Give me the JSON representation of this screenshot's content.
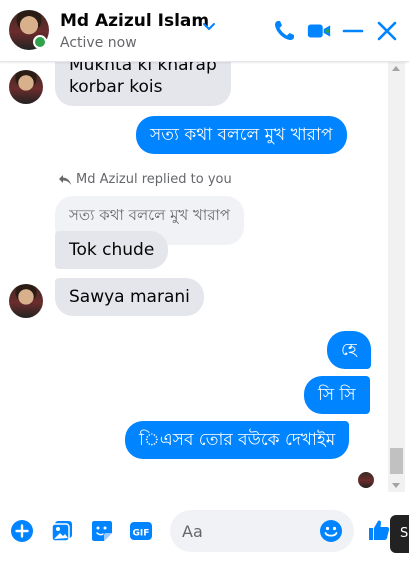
{
  "header": {
    "name": "Md Azizul Islam",
    "status": "Active now"
  },
  "messages": {
    "partial_top_line1": "Mukhta ki kharap",
    "partial_top_line2": "korbar kois",
    "out_1": "সত্য কথা বললে মুখ খারাপ",
    "reply_note": "Md Azizul replied to you",
    "quoted": "সত্য কথা বললে মুখ খারাপ",
    "in_1": "Tok chude",
    "in_2": "Sawya marani",
    "out_2": "হে",
    "out_3": "সি সি",
    "out_4": "িএসব তোর বউকে দেখাইম"
  },
  "composer": {
    "placeholder": "Aa",
    "tooltip_text": "S"
  },
  "colors": {
    "accent": "#0084ff",
    "incoming_bubble": "#e4e6eb",
    "online": "#31a24c"
  },
  "icons": [
    "chevron-down-icon",
    "phone-icon",
    "video-icon",
    "minimize-icon",
    "close-icon",
    "add-icon",
    "image-icon",
    "sticker-icon",
    "gif-icon",
    "emoji-icon",
    "like-icon",
    "reply-icon"
  ]
}
